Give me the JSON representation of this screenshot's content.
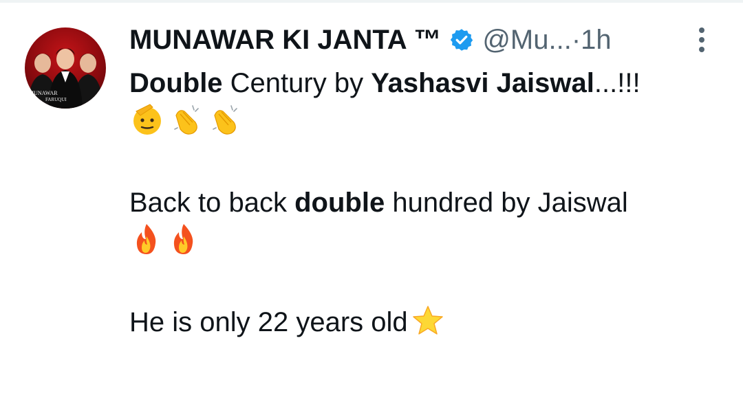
{
  "tweet": {
    "display_name": "MUNAWAR KI JANTA ™",
    "handle": "@Mu...",
    "separator": "·",
    "time": "1h",
    "avatar_text_top": "MUNAWAR",
    "avatar_text_bottom": "FARUQUI",
    "line1": {
      "bold1": "Double",
      "normal1": " Century by ",
      "bold2": "Yashasvi Jaiswal",
      "normal2": "...!!!"
    },
    "emoji_row1": [
      "saluting-face-icon",
      "clapping-hands-icon",
      "clapping-hands-icon"
    ],
    "line2": {
      "normal1": "Back to back ",
      "bold1": "double",
      "normal2": " hundred by Jaiswal"
    },
    "emoji_row2": [
      "fire-icon",
      "fire-icon"
    ],
    "line3": {
      "text": "He is only 22 years old"
    },
    "line3_emoji": "star-icon",
    "colors": {
      "text": "#0f1419",
      "secondary": "#536471",
      "verified": "#1d9bf0"
    }
  }
}
